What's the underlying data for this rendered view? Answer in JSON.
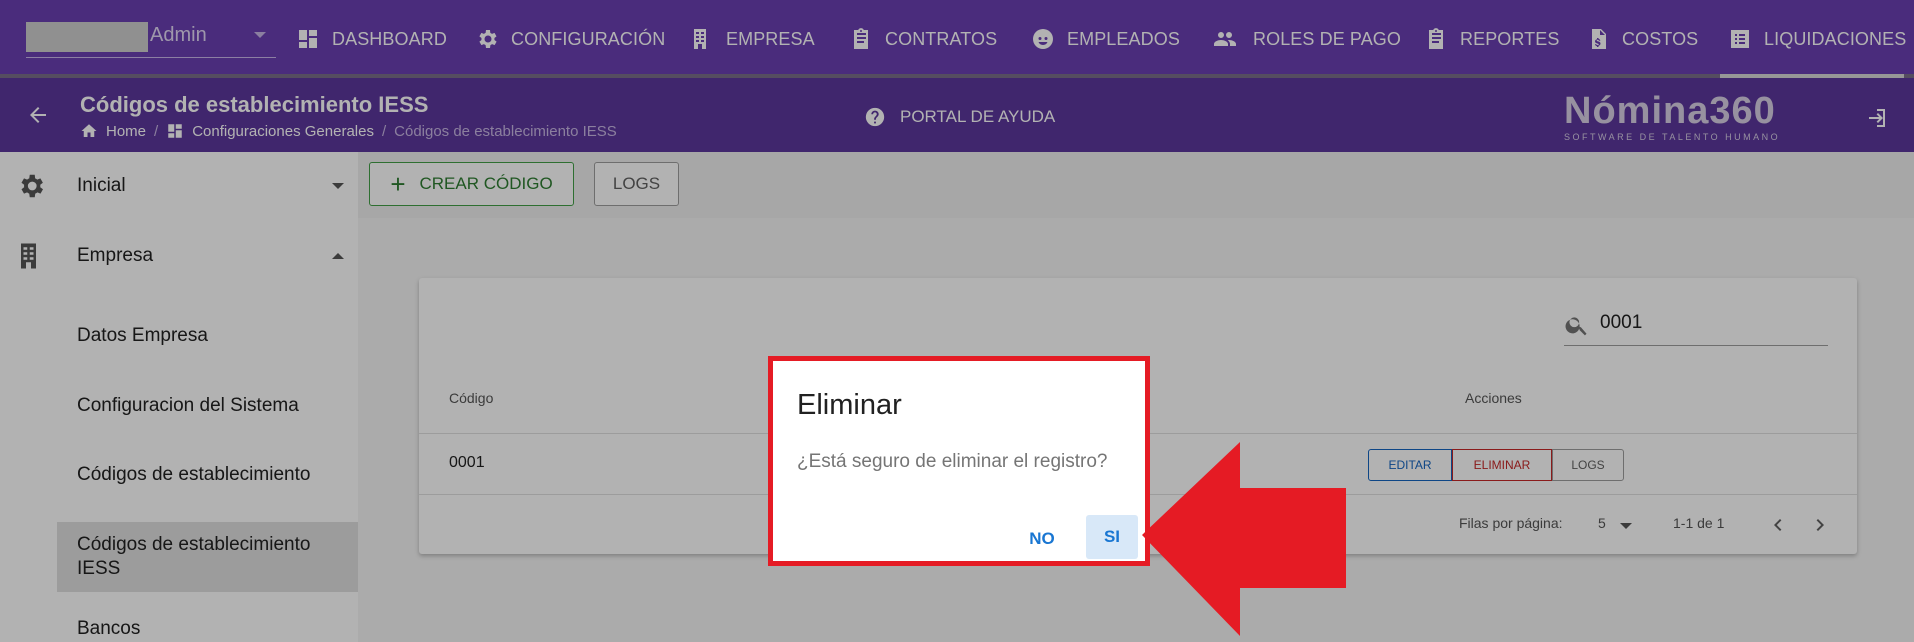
{
  "topnav": {
    "admin_label": "Admin",
    "items": [
      {
        "label": "DASHBOARD",
        "icon": "dashboard-icon"
      },
      {
        "label": "CONFIGURACIÓN",
        "icon": "gear-icon"
      },
      {
        "label": "EMPRESA",
        "icon": "building-icon"
      },
      {
        "label": "CONTRATOS",
        "icon": "clipboard-icon"
      },
      {
        "label": "EMPLEADOS",
        "icon": "face-icon"
      },
      {
        "label": "ROLES DE PAGO",
        "icon": "people-icon"
      },
      {
        "label": "REPORTES",
        "icon": "clipboard-icon"
      },
      {
        "label": "COSTOS",
        "icon": "dollar-file-icon"
      },
      {
        "label": "LIQUIDACIONES",
        "icon": "list-icon"
      }
    ]
  },
  "header": {
    "title": "Códigos de establecimiento IESS",
    "breadcrumbs": [
      "Home",
      "Configuraciones Generales",
      "Códigos de establecimiento IESS"
    ],
    "help_label": "PORTAL DE AYUDA",
    "logo_main": "Nómina360",
    "logo_sub": "SOFTWARE DE TALENTO HUMANO"
  },
  "sidebar": {
    "groups": [
      {
        "label": "Inicial",
        "icon": "gear-icon",
        "expanded": false
      },
      {
        "label": "Empresa",
        "icon": "building-icon",
        "expanded": true
      }
    ],
    "items": [
      {
        "label": "Datos Empresa"
      },
      {
        "label": "Configuracion del Sistema"
      },
      {
        "label": "Códigos de establecimiento"
      },
      {
        "label": "Códigos de establecimiento IESS",
        "active": true
      },
      {
        "label": "Bancos"
      }
    ]
  },
  "toolbar": {
    "create_label": "CREAR CÓDIGO",
    "logs_label": "LOGS"
  },
  "table": {
    "search_value": "0001",
    "columns": [
      "Código",
      "Acciones"
    ],
    "rows": [
      {
        "codigo": "0001"
      }
    ],
    "actions": {
      "edit": "EDITAR",
      "delete": "ELIMINAR",
      "logs": "LOGS"
    },
    "pagination": {
      "rows_label": "Filas por página:",
      "rows_value": "5",
      "range": "1-1 de 1"
    }
  },
  "dialog": {
    "title": "Eliminar",
    "message": "¿Está seguro de eliminar el registro?",
    "no_label": "NO",
    "yes_label": "SI"
  },
  "colors": {
    "nav_bg": "#6a3fb2",
    "header_bg": "#5c379c",
    "highlight_red": "#e51b24",
    "primary_blue": "#1976d2",
    "create_green": "#43a047"
  }
}
